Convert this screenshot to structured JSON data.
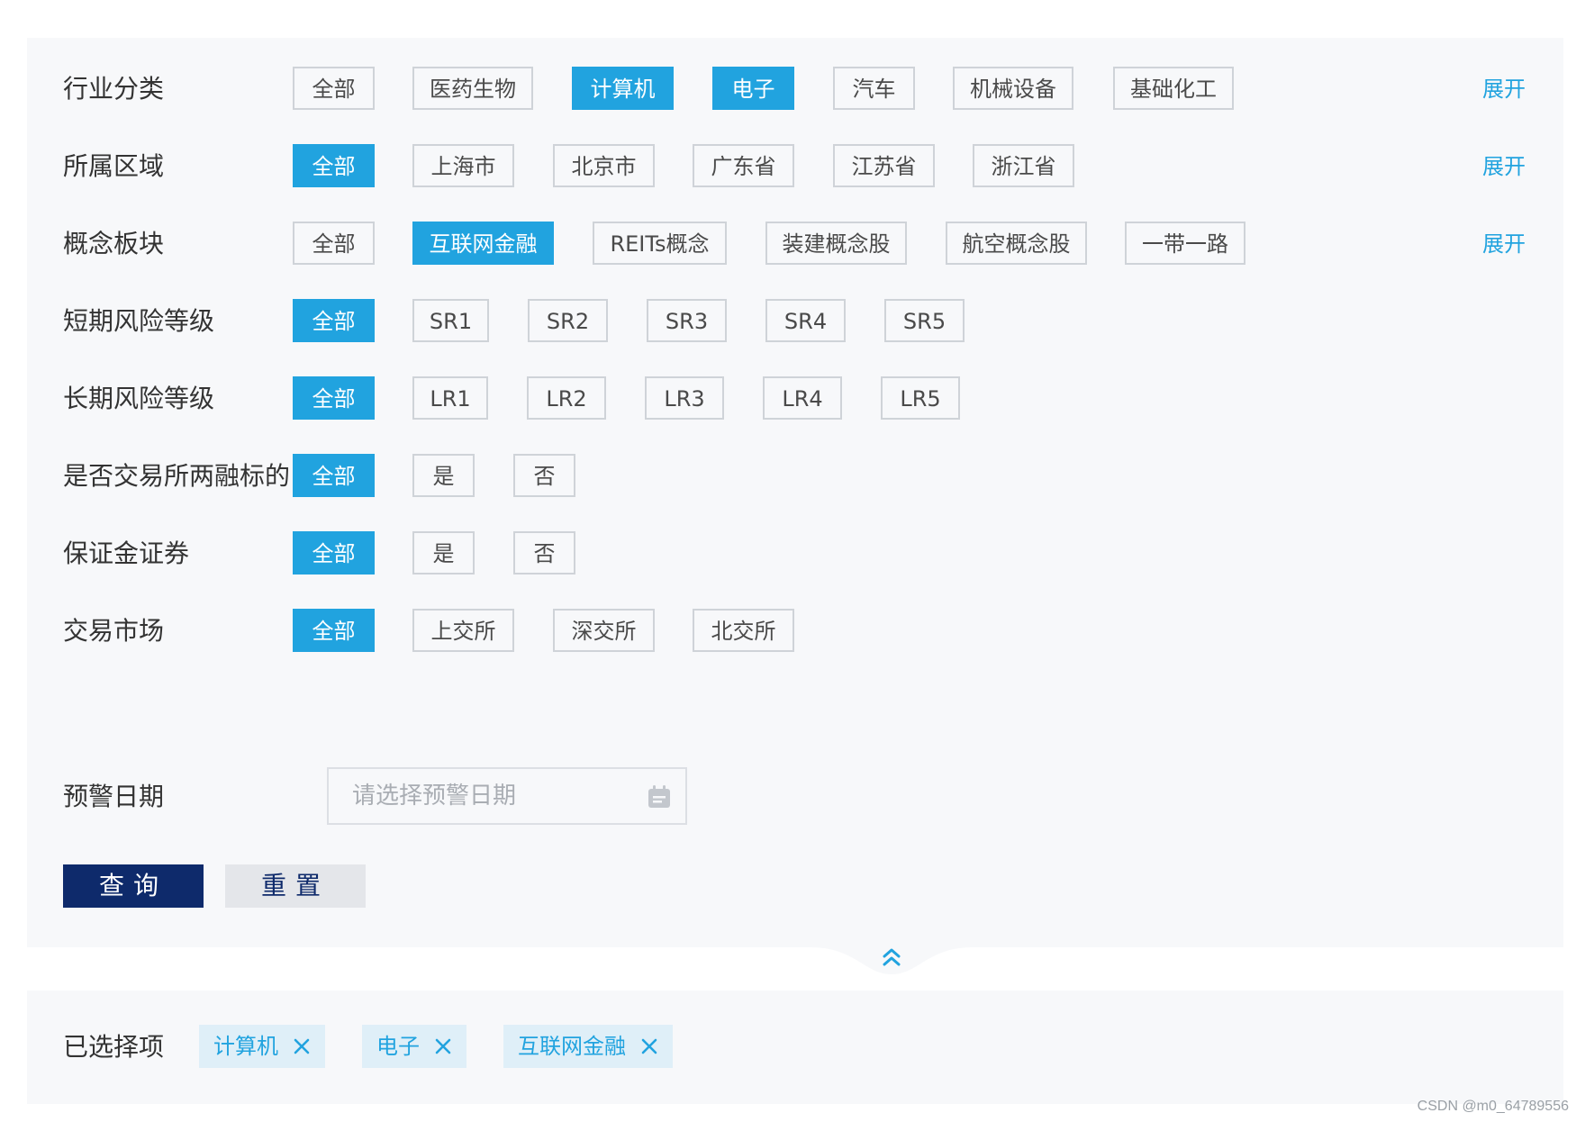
{
  "filters": {
    "industry": {
      "label": "行业分类",
      "options": [
        "全部",
        "医药生物",
        "计算机",
        "电子",
        "汽车",
        "机械设备",
        "基础化工"
      ],
      "selected": [
        "计算机",
        "电子"
      ],
      "expand_label": "展开"
    },
    "region": {
      "label": "所属区域",
      "options": [
        "全部",
        "上海市",
        "北京市",
        "广东省",
        "江苏省",
        "浙江省"
      ],
      "selected": [
        "全部"
      ],
      "expand_label": "展开"
    },
    "concept": {
      "label": "概念板块",
      "options": [
        "全部",
        "互联网金融",
        "REITs概念",
        "装建概念股",
        "航空概念股",
        "一带一路"
      ],
      "selected": [
        "互联网金融"
      ],
      "expand_label": "展开"
    },
    "short_risk": {
      "label": "短期风险等级",
      "options": [
        "全部",
        "SR1",
        "SR2",
        "SR3",
        "SR4",
        "SR5"
      ],
      "selected": [
        "全部"
      ]
    },
    "long_risk": {
      "label": "长期风险等级",
      "options": [
        "全部",
        "LR1",
        "LR2",
        "LR3",
        "LR4",
        "LR5"
      ],
      "selected": [
        "全部"
      ]
    },
    "margin_target": {
      "label": "是否交易所两融标的",
      "options": [
        "全部",
        "是",
        "否"
      ],
      "selected": [
        "全部"
      ]
    },
    "collateral": {
      "label": "保证金证券",
      "options": [
        "全部",
        "是",
        "否"
      ],
      "selected": [
        "全部"
      ]
    },
    "market": {
      "label": "交易市场",
      "options": [
        "全部",
        "上交所",
        "深交所",
        "北交所"
      ],
      "selected": [
        "全部"
      ]
    }
  },
  "date_filter": {
    "label": "预警日期",
    "placeholder": "请选择预警日期",
    "value": ""
  },
  "actions": {
    "query_label": "查询",
    "reset_label": "重置"
  },
  "selected_items": {
    "label": "已选择项",
    "tags": [
      "计算机",
      "电子",
      "互联网金融"
    ]
  },
  "watermark": "CSDN @m0_64789556",
  "icons": {
    "calendar": "calendar-icon",
    "collapse": "double-chevron-up-icon",
    "tag_close": "close-icon"
  },
  "colors": {
    "accent": "#21a3df",
    "primary_button": "#0e2a6b",
    "secondary_button": "#e4e6ea",
    "panel_bg": "#f7f8fa",
    "chip_border": "#cfd3d8",
    "tag_bg": "#dfeff8"
  }
}
